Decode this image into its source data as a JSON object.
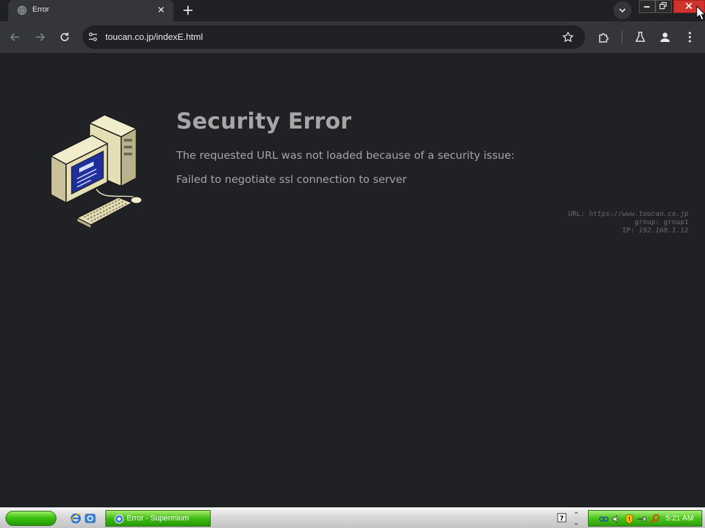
{
  "browser": {
    "tab": {
      "title": "Error"
    },
    "address_bar": {
      "url": "toucan.co.jp/indexE.html"
    }
  },
  "page": {
    "title": "Security Error",
    "message": "The requested URL was not loaded because of a security issue:",
    "detail": "Failed to negotiate ssl connection to server",
    "info": {
      "url_label": "URL:",
      "url_value": "https://www.toucan.co.jp",
      "group_label": "group:",
      "group_value": "group1",
      "ip_label": "IP:",
      "ip_value": "192.168.1.12"
    }
  },
  "taskbar": {
    "task_item_label": "Error - Supermium",
    "clock": "5:21 AM"
  },
  "colors": {
    "page_bg": "#202124",
    "title_text": "#a6a6a6",
    "info_text": "#6a6a6a",
    "close_button": "#d0332e",
    "taskbar_green": "#3ec112"
  }
}
